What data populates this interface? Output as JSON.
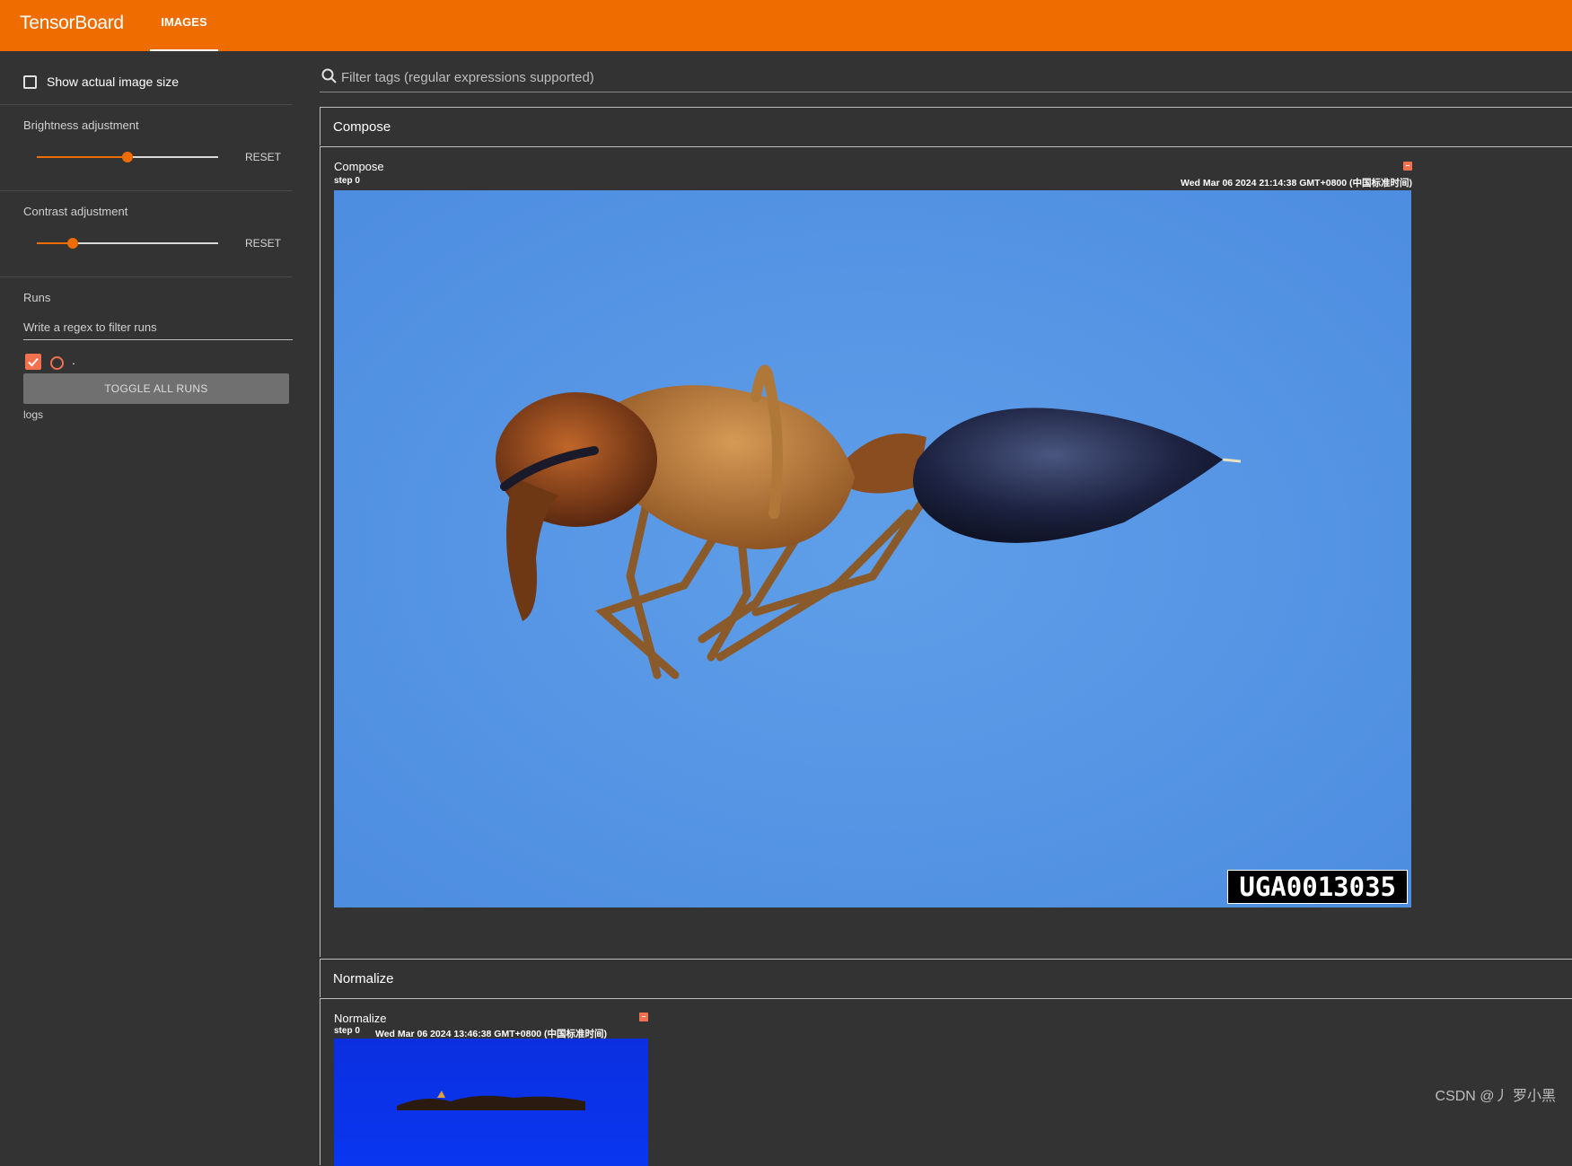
{
  "app": {
    "title": "TensorBoard"
  },
  "tabs": [
    {
      "label": "IMAGES"
    }
  ],
  "sidebar": {
    "show_actual_size_label": "Show actual image size",
    "brightness": {
      "label": "Brightness adjustment",
      "reset_label": "RESET",
      "level": 0.5
    },
    "contrast": {
      "label": "Contrast adjustment",
      "reset_label": "RESET",
      "level": 0.2
    },
    "runs": {
      "title": "Runs",
      "filter_placeholder": "Write a regex to filter runs",
      "items": [
        {
          "label": ".",
          "checked": true
        }
      ],
      "toggle_all_label": "TOGGLE ALL RUNS",
      "logdir": "logs"
    }
  },
  "main": {
    "filter_placeholder": "Filter tags (regular expressions supported)",
    "groups": [
      {
        "title": "Compose",
        "card": {
          "title": "Compose",
          "step_label": "step",
          "step": "0",
          "timestamp": "Wed Mar 06 2024 21:14:38 GMT+0800 (中国标准时间)",
          "image_tag": "UGA0013035"
        }
      },
      {
        "title": "Normalize",
        "card": {
          "title": "Normalize",
          "step_label": "step",
          "step": "0",
          "timestamp": "Wed Mar 06 2024 13:46:38 GMT+0800 (中国标准时间)"
        }
      }
    ]
  },
  "watermark": "CSDN @丿 罗小黑",
  "colors": {
    "accent": "#ef6c00",
    "run_color": "#f4714f",
    "background": "#333333"
  }
}
